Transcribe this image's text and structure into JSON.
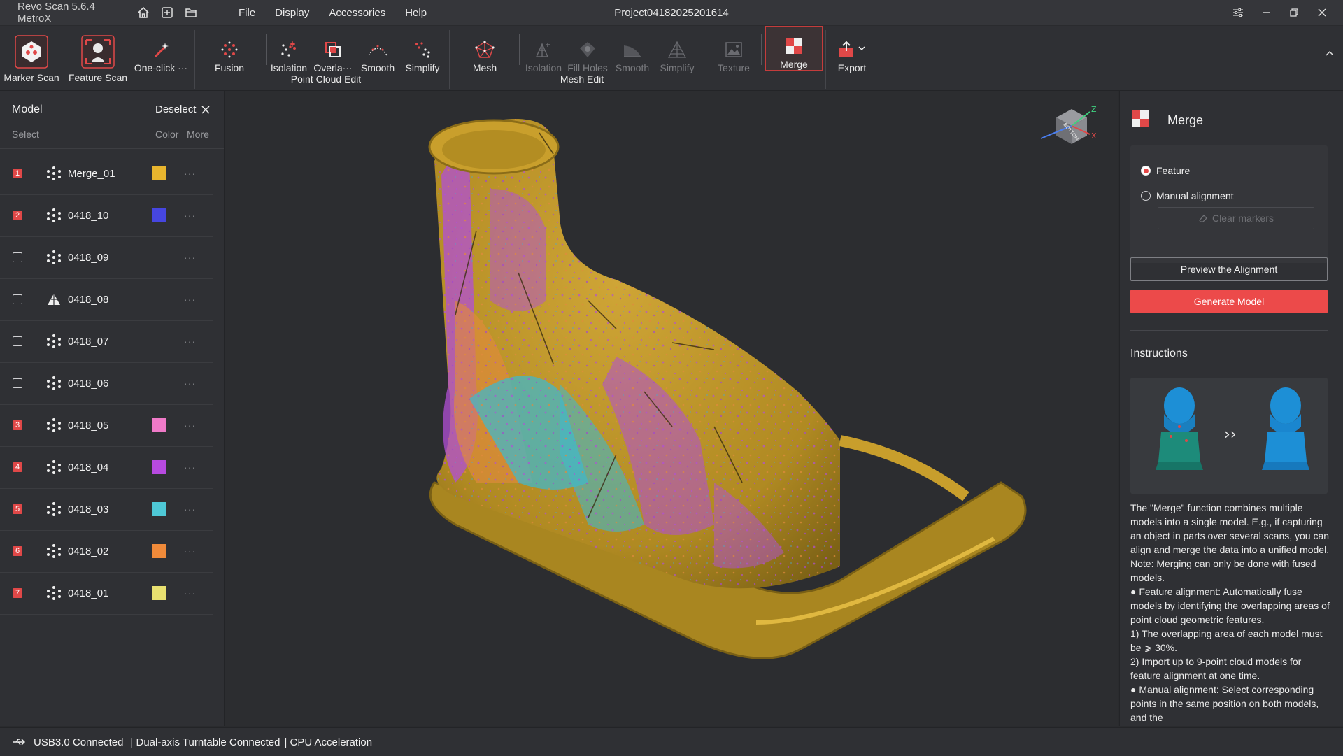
{
  "titlebar": {
    "app_title": "Revo Scan 5.6.4 MetroX",
    "project_title": "Project04182025201614",
    "menu": [
      "File",
      "Display",
      "Accessories",
      "Help"
    ]
  },
  "toolbar": {
    "marker_scan": "Marker Scan",
    "feature_scan": "Feature Scan",
    "one_click": "One-click ···",
    "fusion": "Fusion",
    "pc_isolation": "Isolation",
    "pc_overlap": "Overla···",
    "pc_smooth": "Smooth",
    "pc_simplify": "Simplify",
    "point_cloud_edit": "Point Cloud Edit",
    "mesh": "Mesh",
    "m_isolation": "Isolation",
    "m_fill_holes": "Fill Holes",
    "m_smooth": "Smooth",
    "m_simplify": "Simplify",
    "mesh_edit": "Mesh Edit",
    "texture": "Texture",
    "merge": "Merge",
    "export": "Export"
  },
  "left_panel": {
    "title": "Model",
    "deselect": "Deselect",
    "select_label": "Select",
    "color_label": "Color",
    "more_label": "More",
    "models": [
      {
        "badge": "1",
        "name": "Merge_01",
        "color": "#e8b52e",
        "type": "points"
      },
      {
        "badge": "2",
        "name": "0418_10",
        "color": "#4646e0",
        "type": "points"
      },
      {
        "badge": "",
        "name": "0418_09",
        "color": "",
        "type": "points"
      },
      {
        "badge": "",
        "name": "0418_08",
        "color": "",
        "type": "mesh"
      },
      {
        "badge": "",
        "name": "0418_07",
        "color": "",
        "type": "points"
      },
      {
        "badge": "",
        "name": "0418_06",
        "color": "",
        "type": "points"
      },
      {
        "badge": "3",
        "name": "0418_05",
        "color": "#f07ac8",
        "type": "points"
      },
      {
        "badge": "4",
        "name": "0418_04",
        "color": "#b74ae0",
        "type": "points"
      },
      {
        "badge": "5",
        "name": "0418_03",
        "color": "#4ec8d6",
        "type": "points"
      },
      {
        "badge": "6",
        "name": "0418_02",
        "color": "#f08a3a",
        "type": "points"
      },
      {
        "badge": "7",
        "name": "0418_01",
        "color": "#e8e070",
        "type": "points"
      }
    ],
    "more_glyph": "···"
  },
  "gizmo": {
    "z": "Z",
    "x": "X",
    "face": "BOTTOM"
  },
  "right_panel": {
    "title": "Merge",
    "opt_feature": "Feature",
    "opt_manual": "Manual alignment",
    "clear_markers": "Clear markers",
    "preview": "Preview the Alignment",
    "generate": "Generate Model",
    "instructions_title": "Instructions",
    "arrow": "››",
    "instructions": [
      "The \"Merge\" function combines multiple models into a single model. E.g., if capturing an object in parts over several scans, you can align and merge the data into a unified model. Note: Merging can only be done with fused models.",
      "● Feature alignment: Automatically fuse models by identifying the overlapping areas of point cloud geometric features.",
      "1) The overlapping area of each model must be ⩾ 30%.",
      "2) Import up to 9-point cloud models for feature alignment at one time.",
      "● Manual alignment: Select corresponding points in the same position on both models, and the"
    ]
  },
  "statusbar": {
    "usb": "USB3.0 Connected",
    "turntable": "| Dual-axis Turntable Connected",
    "cpu": "| CPU Acceleration"
  }
}
